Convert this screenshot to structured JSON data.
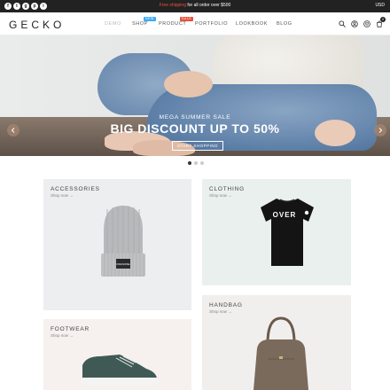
{
  "topbar": {
    "social_icons": [
      "facebook-icon",
      "twitter-icon",
      "google-plus-icon",
      "pinterest-icon",
      "instagram-icon"
    ],
    "promo_highlight": "Free shipping",
    "promo_text": " for all order over $500",
    "currency": "USD"
  },
  "header": {
    "logo": "GECKO",
    "nav": [
      {
        "label": "DEMO",
        "active": true
      },
      {
        "label": "SHOP",
        "badge": "NEW",
        "badge_color": "#3fa9f5"
      },
      {
        "label": "PRODUCT",
        "badge": "SALE",
        "badge_color": "#e8503a"
      },
      {
        "label": "PORTFOLIO"
      },
      {
        "label": "LOOKBOOK"
      },
      {
        "label": "BLOG"
      }
    ],
    "icons": [
      "search-icon",
      "user-icon",
      "heart-icon",
      "cart-icon"
    ],
    "cart_count": "0"
  },
  "hero": {
    "subtitle": "MEGA SUMMER SALE",
    "title": "BIG DISCOUNT UP TO 50%",
    "button": "START SHOPPING",
    "slides": 3,
    "active_slide": 0
  },
  "categories": [
    {
      "title": "ACCESSORIES",
      "link": "Shop now →"
    },
    {
      "title": "CLOTHING",
      "link": "Shop now →"
    },
    {
      "title": "HANDBAG",
      "link": "Shop now →"
    },
    {
      "title": "FOOTWEAR",
      "link": "Shop now →"
    }
  ],
  "clothing_tee_text": "OVER",
  "beanie_label": "PARADISE",
  "colors": {
    "topbar": "#222222",
    "accent_sale": "#e8503a",
    "accent_new": "#3fa9f5"
  }
}
